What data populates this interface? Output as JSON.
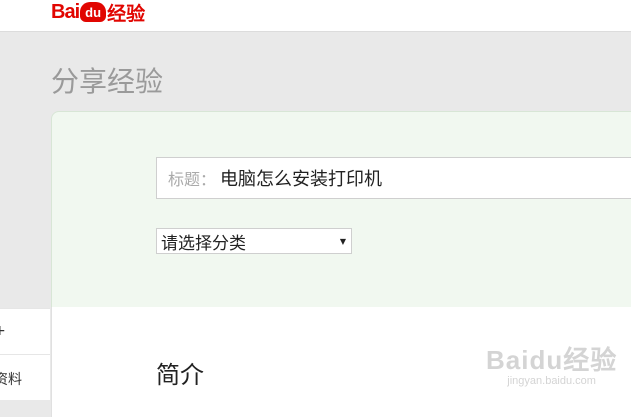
{
  "header": {
    "logo_text": "Baidu经验"
  },
  "page": {
    "title": "分享经验"
  },
  "form": {
    "title_prefix": "标题：",
    "title_value": "电脑怎么安装打印机",
    "category_selected": "请选择分类"
  },
  "main": {
    "intro_heading": "简介"
  },
  "sidebar": {
    "items": [
      {
        "label": "+"
      },
      {
        "label": "资料"
      }
    ]
  },
  "watermark": {
    "logo": "Baidu经验",
    "url": "jingyan.baidu.com"
  },
  "colors": {
    "brand": "#e10601",
    "panel_bg": "#f1f8f0",
    "page_bg": "#e9e9e9"
  }
}
